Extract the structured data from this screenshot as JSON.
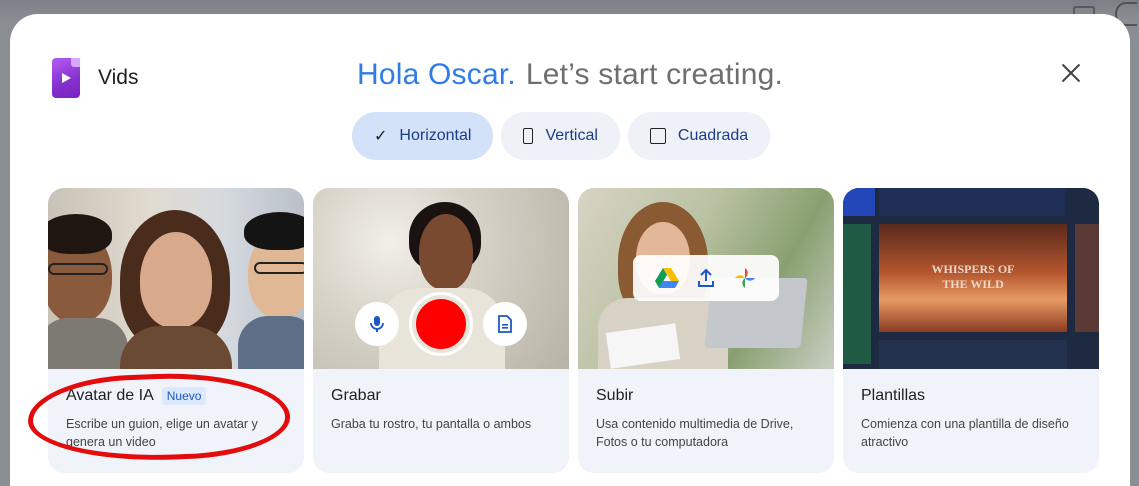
{
  "brand": {
    "name": "Vids"
  },
  "heading": {
    "hello": "Hola Oscar.",
    "rest": "Let’s start creating."
  },
  "formats": [
    {
      "label": "Horizontal",
      "icon": "check-icon",
      "selected": true
    },
    {
      "label": "Vertical",
      "icon": "vertical-rect-icon",
      "selected": false
    },
    {
      "label": "Cuadrada",
      "icon": "square-icon",
      "selected": false
    }
  ],
  "cards": [
    {
      "title": "Avatar de IA",
      "badge": "Nuevo",
      "description": "Escribe un guion, elige un avatar y genera un video"
    },
    {
      "title": "Grabar",
      "description": "Graba tu rostro, tu pantalla o ambos"
    },
    {
      "title": "Subir",
      "description": "Usa contenido multimedia de Drive, Fotos o tu computadora"
    },
    {
      "title": "Plantillas",
      "description": "Comienza con una plantilla de diseño atractivo"
    }
  ],
  "template_preview": {
    "title_line1": "WHISPERS OF",
    "title_line2": "THE WILD"
  },
  "colors": {
    "accent": "#2f7ce6",
    "chip_active": "#d3e1f9",
    "record": "#ff0000",
    "annotation": "#e30b0b"
  }
}
